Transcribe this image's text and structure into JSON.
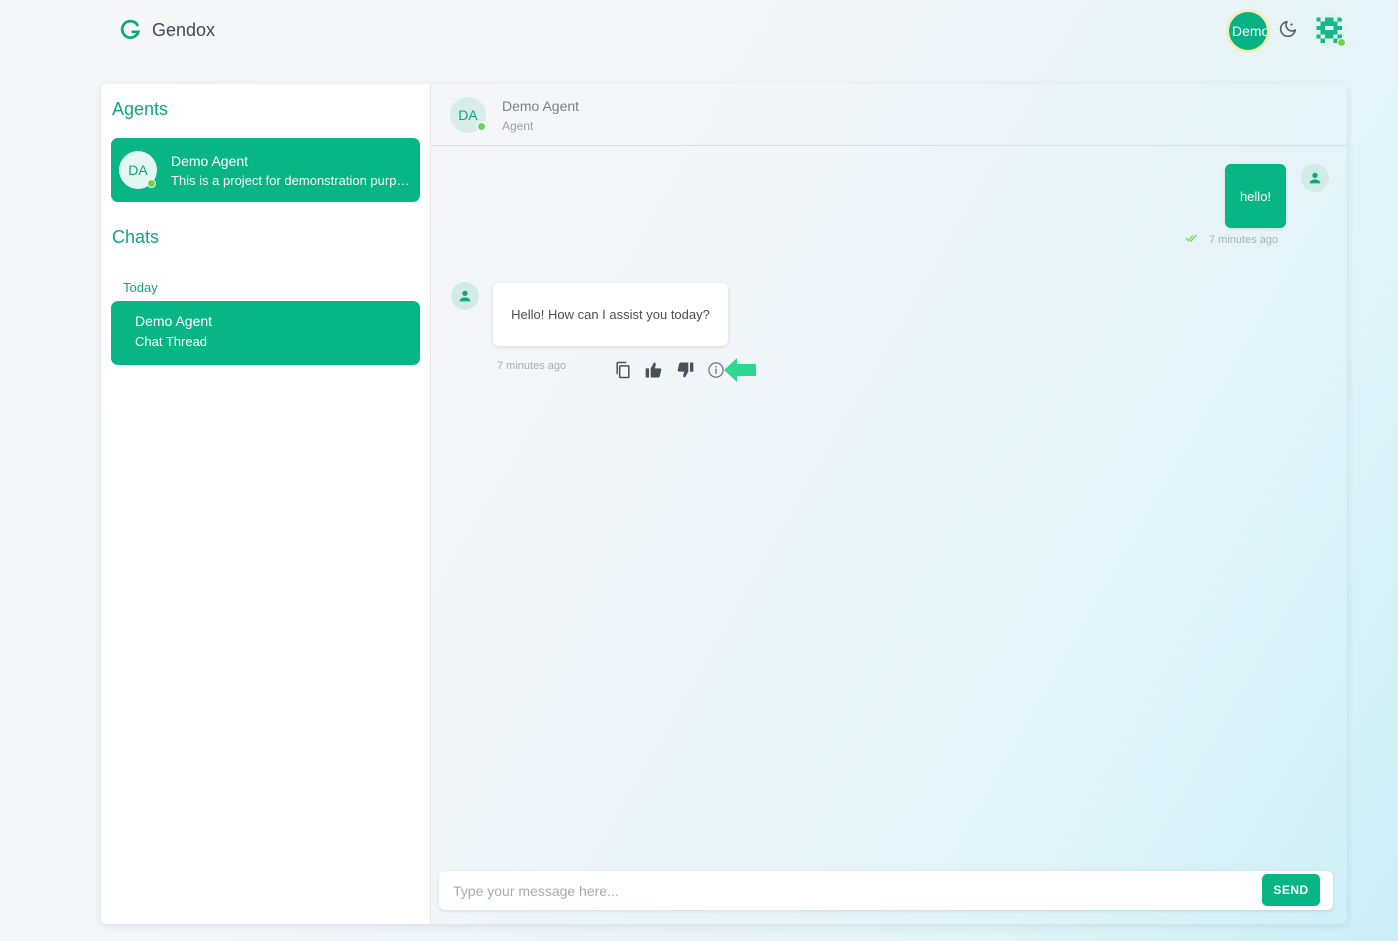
{
  "app": {
    "name": "Gendox",
    "logo_icon": "gendox-logo-icon"
  },
  "topbar": {
    "org_badge": "Demo",
    "theme_icon": "moon-icon",
    "user_icon": "pixel-avatar-icon"
  },
  "sidebar": {
    "agents_title": "Agents",
    "agent": {
      "initials": "DA",
      "name": "Demo Agent",
      "description": "This is a project for demonstration purposes"
    },
    "chats_title": "Chats",
    "group_label": "Today",
    "chat": {
      "title": "Demo Agent",
      "subtitle": "Chat Thread"
    }
  },
  "chat": {
    "header": {
      "initials": "DA",
      "name": "Demo Agent",
      "role": "Agent"
    },
    "messages": [
      {
        "sender": "user",
        "text": "hello!",
        "time": "7 minutes ago"
      },
      {
        "sender": "agent",
        "text": "Hello! How can I assist you today?",
        "time": "7 minutes ago"
      }
    ],
    "composer": {
      "placeholder": "Type your message here...",
      "send_label": "SEND"
    }
  },
  "colors": {
    "accent": "#07b585",
    "online": "#6ed24c",
    "highlight_arrow": "#2fd890"
  }
}
